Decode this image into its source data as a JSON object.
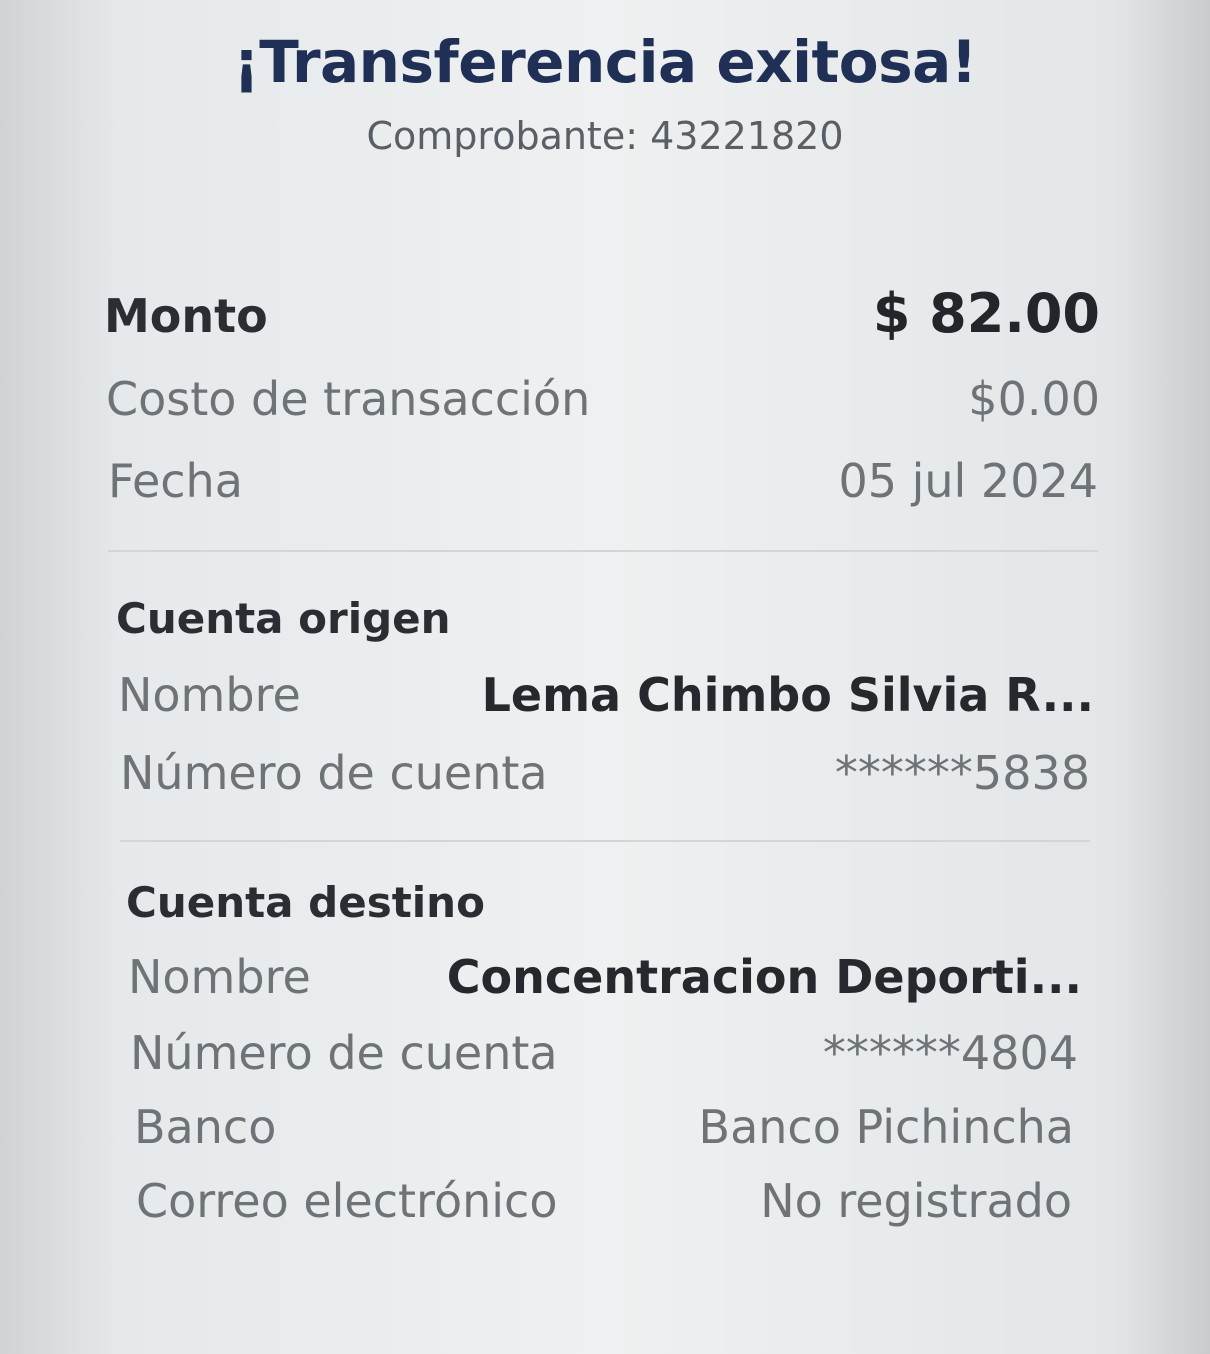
{
  "title": "¡Transferencia exitosa!",
  "receipt": "Comprobante: 43221820",
  "summary": {
    "amount_label": "Monto",
    "amount_value": "$ 82.00",
    "fee_label": "Costo de transacción",
    "fee_value": "$0.00",
    "date_label": "Fecha",
    "date_value": "05 jul 2024"
  },
  "origin": {
    "heading": "Cuenta origen",
    "name_label": "Nombre",
    "name_value": "Lema  Chimbo Silvia R...",
    "account_label": "Número de cuenta",
    "account_value": "******5838"
  },
  "destination": {
    "heading": "Cuenta destino",
    "name_label": "Nombre",
    "name_value": "Concentracion Deporti...",
    "account_label": "Número de cuenta",
    "account_value": "******4804",
    "bank_label": "Banco",
    "bank_value": "Banco Pichincha",
    "email_label": "Correo electrónico",
    "email_value": "No registrado"
  }
}
